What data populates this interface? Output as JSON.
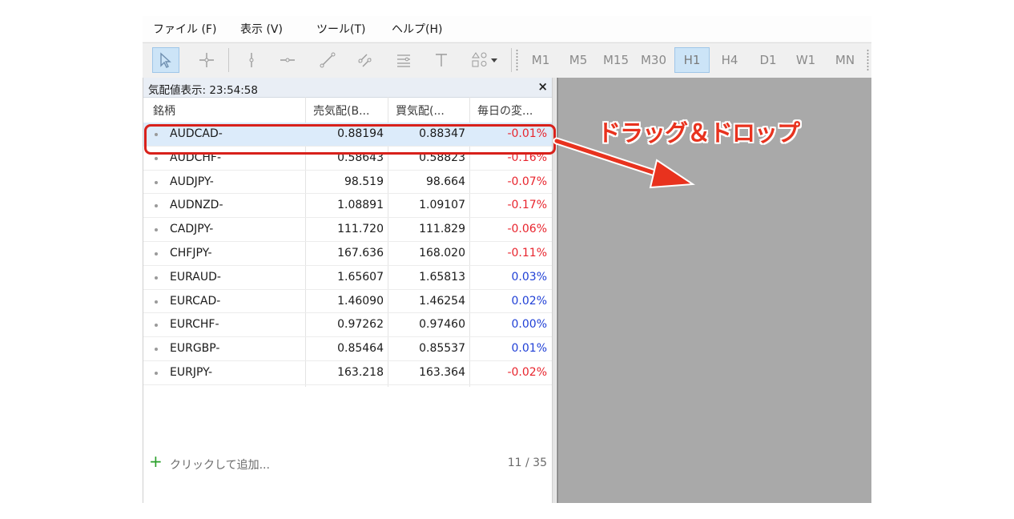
{
  "menu": [
    "ファイル (F)",
    "表示 (V)",
    "ツール(T)",
    "ヘルプ(H)"
  ],
  "toolbar": {
    "tools": [
      "cursor-icon",
      "crosshair-icon",
      "vertical-line-icon",
      "horizontal-line-icon",
      "trendline-icon",
      "channel-icon",
      "fibonacci-icon",
      "text-icon",
      "shapes-icon"
    ],
    "active_tool": "cursor-icon",
    "timeframes": [
      "M1",
      "M5",
      "M15",
      "M30",
      "H1",
      "H4",
      "D1",
      "W1",
      "MN"
    ],
    "active_timeframe": "H1"
  },
  "market_watch": {
    "title": "気配値表示: 23:54:58",
    "close": "×",
    "columns": {
      "symbol": "銘柄",
      "bid": "売気配(B...",
      "ask": "買気配(...",
      "change": "毎日の変..."
    },
    "rows": [
      {
        "symbol": "AUDCAD-",
        "bid": "0.88194",
        "ask": "0.88347",
        "change": "-0.01%"
      },
      {
        "symbol": "AUDCHF-",
        "bid": "0.58643",
        "ask": "0.58823",
        "change": "-0.16%"
      },
      {
        "symbol": "AUDJPY-",
        "bid": "98.519",
        "ask": "98.664",
        "change": "-0.07%"
      },
      {
        "symbol": "AUDNZD-",
        "bid": "1.08891",
        "ask": "1.09107",
        "change": "-0.17%"
      },
      {
        "symbol": "CADJPY-",
        "bid": "111.720",
        "ask": "111.829",
        "change": "-0.06%"
      },
      {
        "symbol": "CHFJPY-",
        "bid": "167.636",
        "ask": "168.020",
        "change": "-0.11%"
      },
      {
        "symbol": "EURAUD-",
        "bid": "1.65607",
        "ask": "1.65813",
        "change": "0.03%"
      },
      {
        "symbol": "EURCAD-",
        "bid": "1.46090",
        "ask": "1.46254",
        "change": "0.02%"
      },
      {
        "symbol": "EURCHF-",
        "bid": "0.97262",
        "ask": "0.97460",
        "change": "0.00%"
      },
      {
        "symbol": "EURGBP-",
        "bid": "0.85464",
        "ask": "0.85537",
        "change": "0.01%"
      },
      {
        "symbol": "EURJPY-",
        "bid": "163.218",
        "ask": "163.364",
        "change": "-0.02%"
      }
    ],
    "selected_symbol": "AUDCAD-",
    "add_label": "クリックして追加...",
    "count": "11 / 35"
  },
  "annotation": {
    "text": "ドラッグ＆ドロップ",
    "color": "#e8321e"
  },
  "colors": {
    "negative": "#e8242d",
    "positive": "#1f3fd6",
    "chart_background": "#a9a9a9",
    "highlight": "#d8211b"
  }
}
